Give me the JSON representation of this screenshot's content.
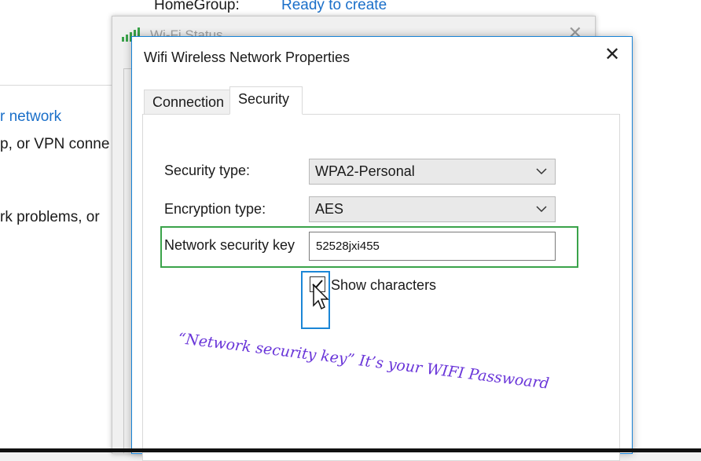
{
  "background": {
    "homegroup_label": "HomeGroup:",
    "homegroup_value": "Ready to create",
    "line_network_link": "r network",
    "line_vpn": "p, or VPN conne",
    "line_problems": "rk problems, or"
  },
  "status_window": {
    "title": "Wi-Fi Status"
  },
  "dialog": {
    "title": "Wifi Wireless Network Properties",
    "close_glyph": "✕",
    "tabs": [
      {
        "label": "Connection"
      },
      {
        "label": "Security"
      }
    ],
    "security_type_label": "Security type:",
    "security_type_value": "WPA2-Personal",
    "encryption_type_label": "Encryption type:",
    "encryption_type_value": "AES",
    "network_key_label": "Network security key",
    "network_key_value": "52528jxi455",
    "show_characters_label": "Show characters",
    "show_characters_checked": true
  },
  "annotation": {
    "text": "“Network security key” It’s your WIFI Passwoard",
    "color": "#6a36d9"
  },
  "colors": {
    "highlight_box": "#3aa34a",
    "focus_box": "#1b86d6",
    "link": "#1a6fc9"
  }
}
